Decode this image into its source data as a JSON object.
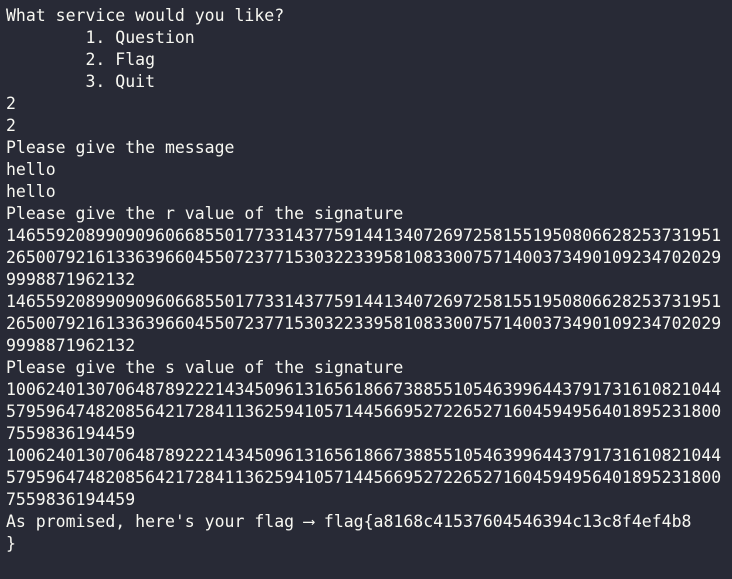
{
  "terminal": {
    "lines": [
      "What service would you like?",
      "        1. Question",
      "        2. Flag",
      "        3. Quit",
      "2",
      "2",
      "Please give the message",
      "hello",
      "hello",
      "Please give the r value of the signature",
      "146559208990909606685501773314377591441340726972581551950806628253731951",
      "265007921613363966045507237715303223395810833007571400373490109234702029",
      "9998871962132",
      "146559208990909606685501773314377591441340726972581551950806628253731951",
      "265007921613363966045507237715303223395810833007571400373490109234702029",
      "9998871962132",
      "Please give the s value of the signature",
      "100624013070648789222143450961316561866738855105463996443791731610821044",
      "579596474820856421728411362594105714456695272265271604594956401895231800",
      "7559836194459",
      "100624013070648789222143450961316561866738855105463996443791731610821044",
      "579596474820856421728411362594105714456695272265271604594956401895231800",
      "7559836194459",
      "As promised, here's your flag ⟶ flag{a8168c41537604546394c13c8f4ef4b8",
      "}"
    ]
  }
}
